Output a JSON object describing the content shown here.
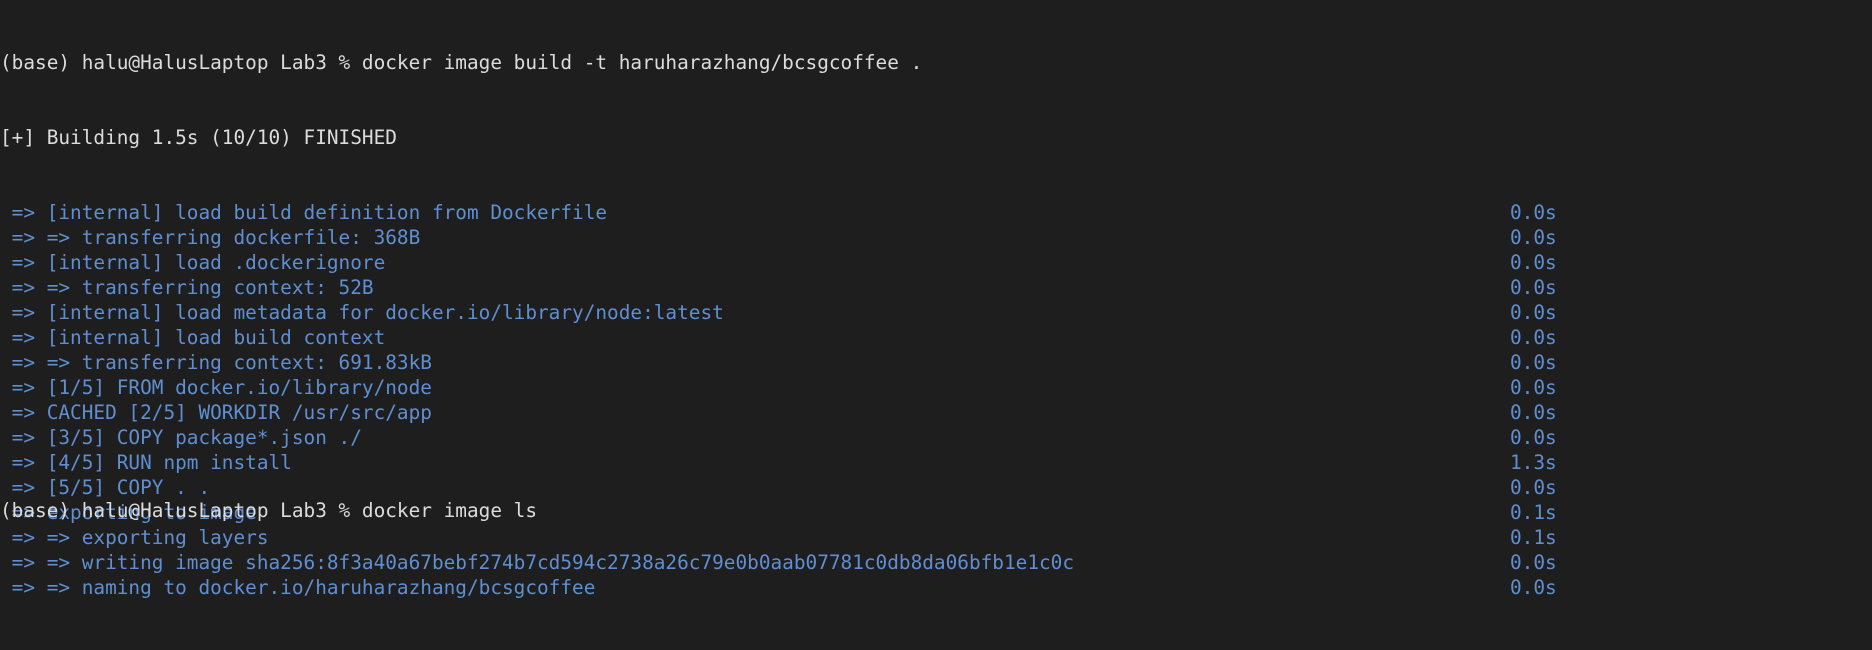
{
  "prompt_line": "(base) halu@HalusLaptop Lab3 % docker image build -t haruharazhang/bcsgcoffee .",
  "status_line": "[+] Building 1.5s (10/10) FINISHED",
  "steps": [
    {
      "text": " => [internal] load build definition from Dockerfile",
      "time": "0.0s"
    },
    {
      "text": " => => transferring dockerfile: 368B",
      "time": "0.0s"
    },
    {
      "text": " => [internal] load .dockerignore",
      "time": "0.0s"
    },
    {
      "text": " => => transferring context: 52B",
      "time": "0.0s"
    },
    {
      "text": " => [internal] load metadata for docker.io/library/node:latest",
      "time": "0.0s"
    },
    {
      "text": " => [internal] load build context",
      "time": "0.0s"
    },
    {
      "text": " => => transferring context: 691.83kB",
      "time": "0.0s"
    },
    {
      "text": " => [1/5] FROM docker.io/library/node",
      "time": "0.0s"
    },
    {
      "text": " => CACHED [2/5] WORKDIR /usr/src/app",
      "time": "0.0s"
    },
    {
      "text": " => [3/5] COPY package*.json ./",
      "time": "0.0s"
    },
    {
      "text": " => [4/5] RUN npm install",
      "time": "1.3s"
    },
    {
      "text": " => [5/5] COPY . .",
      "time": "0.0s"
    },
    {
      "text": " => exporting to image",
      "time": "0.1s"
    },
    {
      "text": " => => exporting layers",
      "time": "0.1s"
    },
    {
      "text": " => => writing image sha256:8f3a40a67bebf274b7cd594c2738a26c79e0b0aab07781c0db8da06bfb1e1c0c",
      "time": "0.0s"
    },
    {
      "text": " => => naming to docker.io/haruharazhang/bcsgcoffee",
      "time": "0.0s"
    }
  ],
  "next_prompt_partial": "(base) halu@HalusLaptop Lab3 % docker image ls",
  "colors": {
    "background": "#1e1e1e",
    "text": "#dcdcdc",
    "step": "#5f8fd2"
  }
}
